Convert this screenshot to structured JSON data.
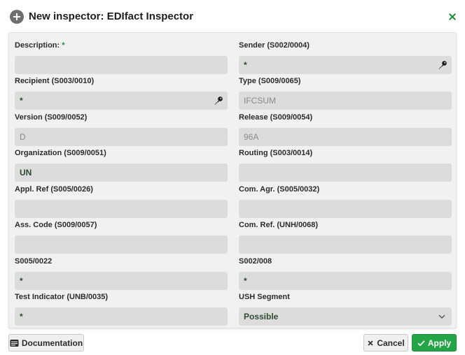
{
  "dialog": {
    "title": "New inspector: EDIfact Inspector",
    "icon": "plus-circle-icon",
    "close_icon": "close-icon"
  },
  "form": {
    "fields": [
      {
        "label": "Description:",
        "required_mark": "*",
        "value": "",
        "muted": false,
        "icon": ""
      },
      {
        "label": "Sender (S002/0004)",
        "value": "*",
        "muted": false,
        "icon": "key-icon"
      },
      {
        "label": "Recipient (S003/0010)",
        "value": "*",
        "muted": false,
        "icon": "key-icon"
      },
      {
        "label": "Type (S009/0065)",
        "value": "IFCSUM",
        "muted": true,
        "icon": ""
      },
      {
        "label": "Version (S009/0052)",
        "value": "D",
        "muted": true,
        "icon": ""
      },
      {
        "label": "Release (S009/0054)",
        "value": "96A",
        "muted": true,
        "icon": ""
      },
      {
        "label": "Organization (S009/0051)",
        "value": "UN",
        "muted": false,
        "icon": ""
      },
      {
        "label": "Routing (S003/0014)",
        "value": "",
        "muted": false,
        "icon": ""
      },
      {
        "label": "Appl. Ref (S005/0026)",
        "value": "",
        "muted": false,
        "icon": ""
      },
      {
        "label": "Com. Agr. (S005/0032)",
        "value": "",
        "muted": false,
        "icon": ""
      },
      {
        "label": "Ass. Code (S009/0057)",
        "value": "",
        "muted": false,
        "icon": ""
      },
      {
        "label": "Com. Ref. (UNH/0068)",
        "value": "",
        "muted": false,
        "icon": ""
      },
      {
        "label": "S005/0022",
        "value": "*",
        "muted": false,
        "icon": ""
      },
      {
        "label": "S002/008",
        "value": "*",
        "muted": false,
        "icon": ""
      },
      {
        "label": "Test Indicator (UNB/0035)",
        "value": "*",
        "muted": false,
        "icon": ""
      },
      {
        "label": "USH Segment",
        "value": "Possible",
        "muted": false,
        "icon": "chevron-down-icon"
      }
    ]
  },
  "buttons": {
    "documentation": "Documentation",
    "cancel": "Cancel",
    "apply": "Apply"
  },
  "colors": {
    "accent": "#22a447",
    "panel": "#f1f1f1",
    "field": "#dcdcdc"
  }
}
